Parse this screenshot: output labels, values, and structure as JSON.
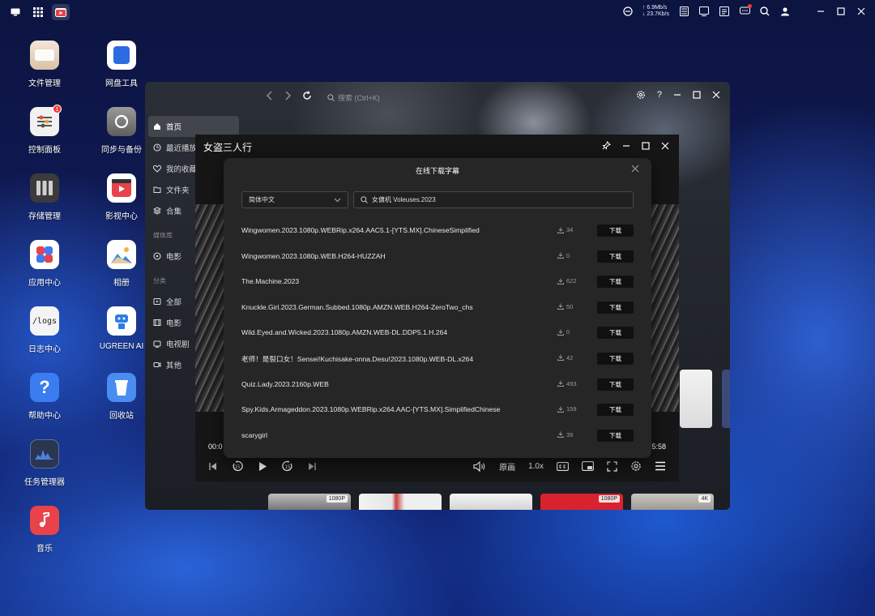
{
  "desktop": {
    "icons": [
      {
        "label": "文件管理"
      },
      {
        "label": "网盘工具"
      },
      {
        "label": "控制面板",
        "badge": "1"
      },
      {
        "label": "同步与备份"
      },
      {
        "label": "存储管理"
      },
      {
        "label": "影视中心"
      },
      {
        "label": "应用中心"
      },
      {
        "label": "相册"
      },
      {
        "label": "日志中心",
        "tile_text": "/logs"
      },
      {
        "label": "UGREEN AI"
      },
      {
        "label": "帮助中心",
        "tile_text": "?"
      },
      {
        "label": "回收站"
      },
      {
        "label": "任务管理器"
      },
      {
        "label": "音乐"
      }
    ]
  },
  "topbar": {
    "net_up": "↑ 6.9Mb/s",
    "net_down": "↓ 23.7Kb/s"
  },
  "player": {
    "search_placeholder": "搜索 (Ctrl+K)",
    "sidebar": {
      "items": [
        {
          "label": "首页"
        },
        {
          "label": "最近播放"
        },
        {
          "label": "我的收藏"
        },
        {
          "label": "文件夹"
        },
        {
          "label": "合集"
        }
      ],
      "library_heading": "媒体库",
      "library_items": [
        {
          "label": "电影"
        }
      ],
      "category_heading": "分类",
      "category_items": [
        {
          "label": "全部"
        },
        {
          "label": "电影"
        },
        {
          "label": "电视剧"
        },
        {
          "label": "其他"
        }
      ]
    },
    "thumb_badges": [
      "1080P",
      "",
      "",
      "1080P",
      "4K"
    ]
  },
  "video": {
    "title": "女盗三人行",
    "time_current": "00:0",
    "time_total": "5:58",
    "audio_track": "原画",
    "speed": "1.0x"
  },
  "subtitle_dialog": {
    "title": "在线下载字幕",
    "language": "简体中文",
    "query": "女傭机 Voleuses.2023",
    "download_label": "下载",
    "results": [
      {
        "name": "Wingwomen.2023.1080p.WEBRip.x264.AAC5.1-[YTS.MX].ChineseSimplified",
        "count": "34"
      },
      {
        "name": "Wingwomen.2023.1080p.WEB.H264-HUZZAH",
        "count": "0"
      },
      {
        "name": "The.Machine.2023",
        "count": "622"
      },
      {
        "name": "Knuckle.Girl.2023.German.Subbed.1080p.AMZN.WEB.H264-ZeroTwo_chs",
        "count": "50"
      },
      {
        "name": "Wild.Eyed.and.Wicked.2023.1080p.AMZN.WEB-DL.DDP5.1.H.264",
        "count": "0"
      },
      {
        "name": "老师！是裂口女！Sensei!Kuchisake-onna.Desu!2023.1080p.WEB-DL.x264",
        "count": "42"
      },
      {
        "name": "Quiz.Lady.2023.2160p.WEB",
        "count": "493"
      },
      {
        "name": "Spy.Kids.Armageddon.2023.1080p.WEBRip.x264.AAC-[YTS.MX].SimplifiedChinese",
        "count": "159"
      },
      {
        "name": "scarygirl",
        "count": "39"
      }
    ]
  }
}
